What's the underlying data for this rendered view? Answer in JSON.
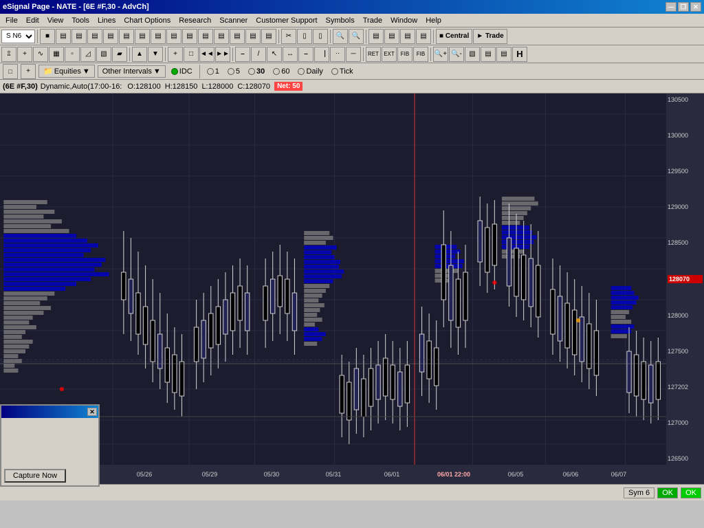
{
  "window": {
    "title": "eSignal Page - NATE - [6E #F,30 - AdvCh]",
    "controls": [
      "—",
      "❐",
      "✕"
    ]
  },
  "menu": {
    "items": [
      "File",
      "Edit",
      "View",
      "Tools",
      "Lines",
      "Chart Options",
      "Research",
      "Scanner",
      "Customer Support",
      "Symbols",
      "Trade",
      "Window",
      "Help"
    ]
  },
  "toolbar1": {
    "select_value": "S N6",
    "buttons": [
      "IDC_logo",
      "chart1",
      "chart2",
      "chart3",
      "chart4",
      "chart5",
      "chart6",
      "chart7",
      "chart8",
      "chart9",
      "chart10",
      "chart11",
      "chart12",
      "chart13",
      "chart14",
      "chart15",
      "cut",
      "copy",
      "paste",
      "undo",
      "search",
      "search2",
      "central",
      "trade"
    ]
  },
  "toolbar2": {
    "buttons": [
      "cursor",
      "crosshair",
      "wave",
      "select1",
      "draw1",
      "draw2",
      "draw3",
      "draw4",
      "up",
      "down",
      "plus",
      "box",
      "arrow_left",
      "arrow_right",
      "tools1",
      "tools2",
      "tools3",
      "tools4",
      "tools5",
      "tools6",
      "zoom_in",
      "zoom_out",
      "eraser",
      "more1",
      "more2",
      "H"
    ]
  },
  "interval_bar": {
    "folder_label": "Equities",
    "other_intervals_label": "Other Intervals",
    "idc_label": "IDC",
    "intervals": [
      {
        "label": "1",
        "active": false
      },
      {
        "label": "5",
        "active": false
      },
      {
        "label": "30",
        "active": true
      },
      {
        "label": "60",
        "active": false
      },
      {
        "label": "Daily",
        "active": false
      },
      {
        "label": "Tick",
        "active": false
      }
    ]
  },
  "chart_info": {
    "symbol": "(6E #F,30)",
    "study": "Dynamic,Auto(17:00-16:",
    "open_label": "O:",
    "open_value": "128100",
    "high_label": "H:",
    "high_value": "128150",
    "low_label": "L:",
    "low_value": "128000",
    "close_label": "C:",
    "close_value": "128070",
    "badge": "Net: 50"
  },
  "price_levels": [
    {
      "value": "130500",
      "y_pct": 2
    },
    {
      "value": "130000",
      "y_pct": 10
    },
    {
      "value": "129500",
      "y_pct": 18
    },
    {
      "value": "129000",
      "y_pct": 26
    },
    {
      "value": "128500",
      "y_pct": 34
    },
    {
      "value": "128000",
      "y_pct": 42
    },
    {
      "value": "127500",
      "y_pct": 50
    },
    {
      "value": "127202",
      "y_pct": 56
    },
    {
      "value": "127000",
      "y_pct": 60
    },
    {
      "value": "126500",
      "y_pct": 68
    }
  ],
  "current_price": {
    "value": "128070",
    "badge_color": "#cc0000"
  },
  "date_labels": [
    "05/26",
    "05/29",
    "05/30",
    "05/31",
    "06/01",
    "06/01 22:00",
    "06/05",
    "06/06",
    "06/07"
  ],
  "status_bar": {
    "sym_label": "Sym 6",
    "ok1_label": "OK",
    "ok2_label": "OK"
  },
  "dialog": {
    "close_label": "✕",
    "capture_btn_label": "Capture Now"
  }
}
